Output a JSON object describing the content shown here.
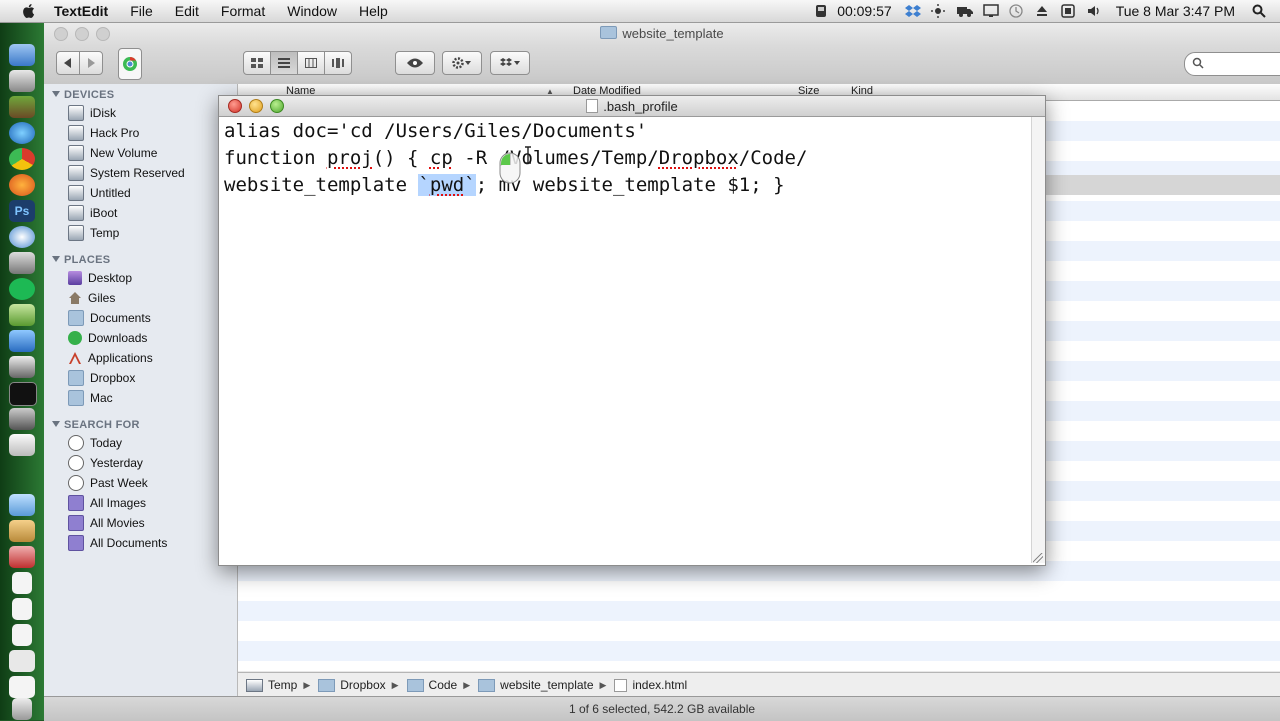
{
  "menubar": {
    "app": "TextEdit",
    "items": [
      "File",
      "Edit",
      "Format",
      "Window",
      "Help"
    ],
    "timer": "00:09:57",
    "clock": "Tue 8 Mar  3:47 PM"
  },
  "finder": {
    "title": "website_template",
    "columns": {
      "name": "Name",
      "date": "Date Modified",
      "size": "Size",
      "kind": "Kind"
    },
    "sidebar": {
      "devices_heading": "DEVICES",
      "devices": [
        "iDisk",
        "Hack Pro",
        "New Volume",
        "System Reserved",
        "Untitled",
        "iBoot",
        "Temp"
      ],
      "places_heading": "PLACES",
      "places": [
        "Desktop",
        "Giles",
        "Documents",
        "Downloads",
        "Applications",
        "Dropbox",
        "Mac"
      ],
      "search_heading": "SEARCH FOR",
      "search": [
        "Today",
        "Yesterday",
        "Past Week",
        "All Images",
        "All Movies",
        "All Documents"
      ]
    },
    "path": [
      "Temp",
      "Dropbox",
      "Code",
      "website_template",
      "index.html"
    ],
    "status": "1 of 6 selected, 542.2 GB available"
  },
  "textedit": {
    "title": ".bash_profile",
    "line1": "alias doc='cd /Users/Giles/Documents'",
    "line2_a": "function ",
    "line2_b": "proj",
    "line2_c": "() { ",
    "line2_d": "cp",
    "line2_e": " -R /Volumes/Temp/",
    "line2_f": "Dropbox",
    "line2_g": "/Code/",
    "line3_a": "website_template ",
    "line3_b": "`",
    "line3_c": "pwd",
    "line3_d": "`",
    "line3_e": "; mv website_template $1; }"
  }
}
